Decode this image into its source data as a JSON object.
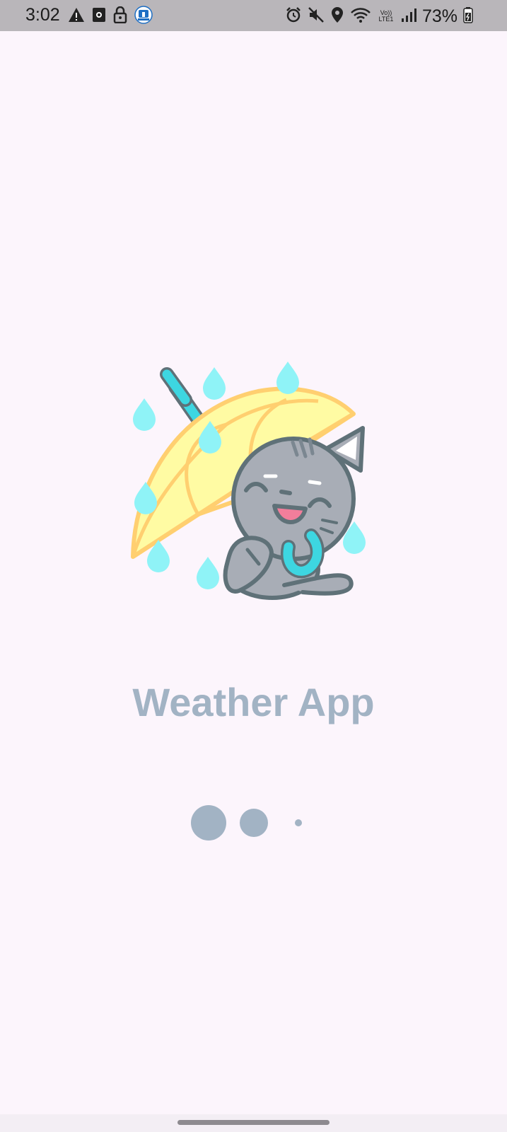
{
  "status_bar": {
    "time": "3:02",
    "battery": "73%",
    "network_label": "Vo)) LTE1",
    "icons_left": [
      "warning-icon",
      "screen-record-icon",
      "lock-icon",
      "app-notification-icon"
    ],
    "icons_right": [
      "alarm-icon",
      "mute-icon",
      "location-icon",
      "wifi-icon",
      "signal-icon",
      "battery-icon"
    ]
  },
  "splash": {
    "illustration": "cat-with-umbrella-in-rain",
    "title": "Weather App"
  },
  "loader": {
    "dots": 3
  },
  "colors": {
    "background": "#FCF5FC",
    "accent": "#A2B3C4",
    "umbrella": "#FFFBA3",
    "umbrella_outline": "#FFCF70",
    "raindrop": "#8FF3F7",
    "cat": "#A8ADB6",
    "outline": "#5F7178",
    "handle": "#3DD6E1"
  }
}
